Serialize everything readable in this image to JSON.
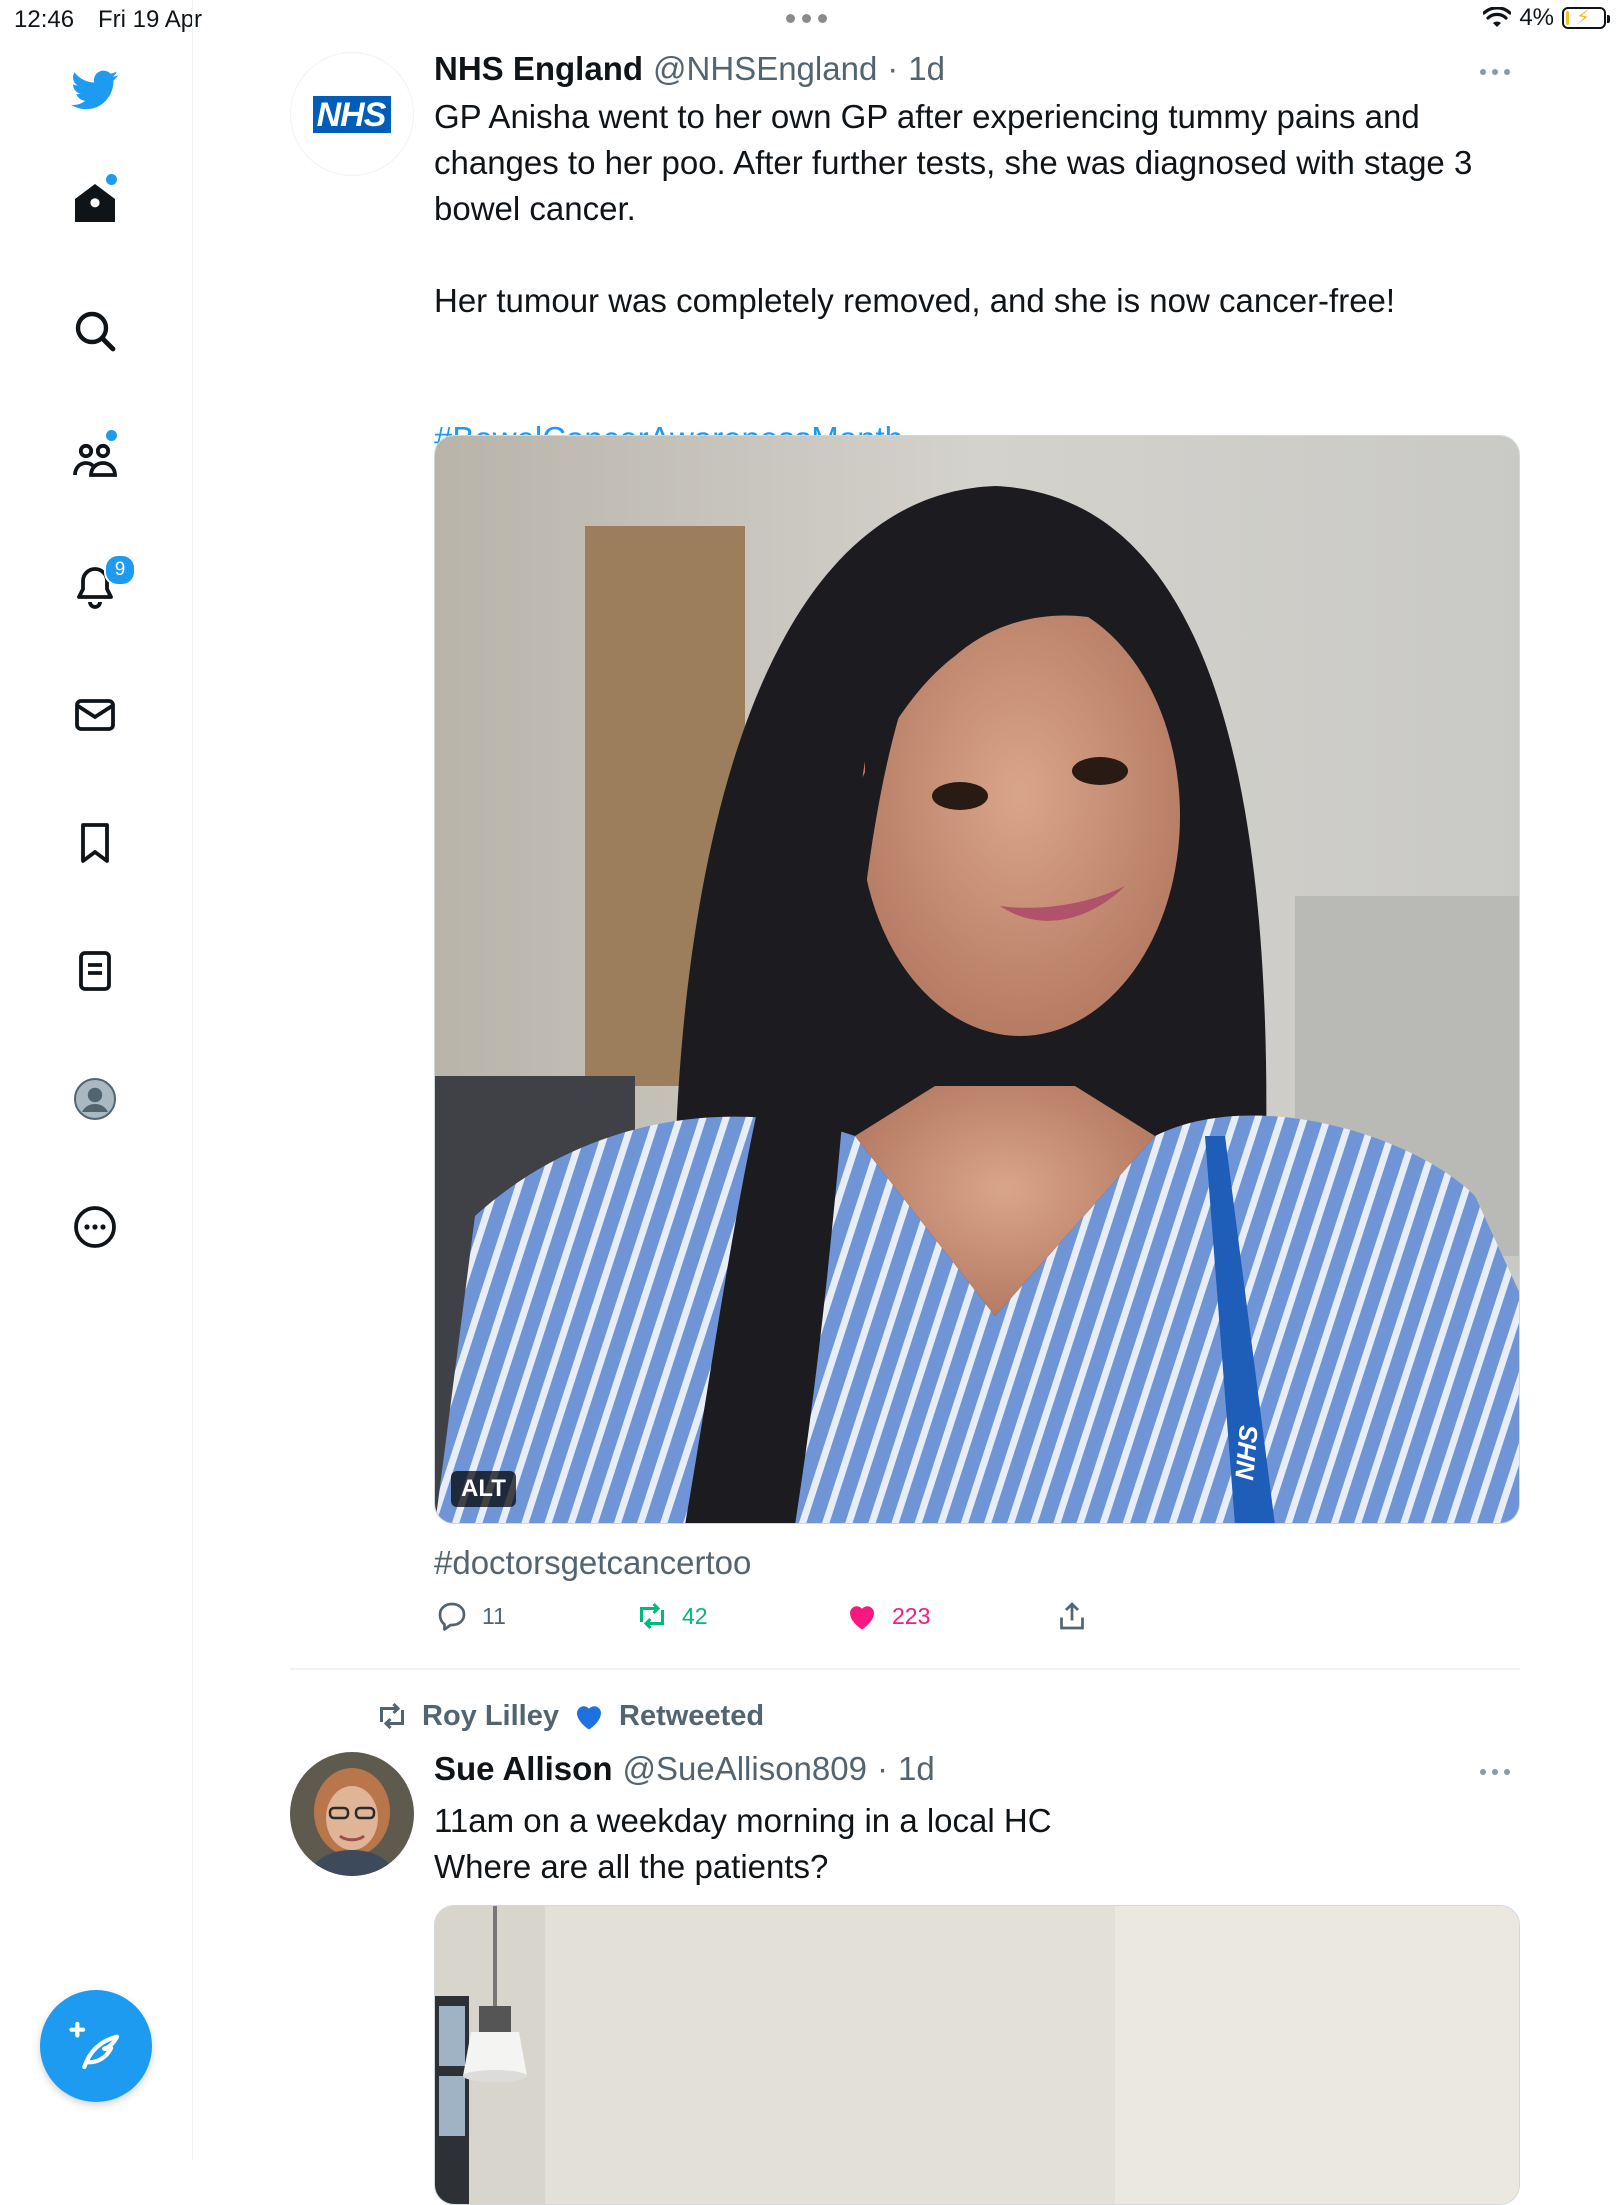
{
  "status_bar": {
    "time": "12:46",
    "date": "Fri 19 Apr",
    "battery": "4%"
  },
  "sidebar": {
    "items": [
      {
        "icon": "twitter-bird-icon"
      },
      {
        "icon": "home-icon",
        "has_dot": true
      },
      {
        "icon": "search-icon"
      },
      {
        "icon": "communities-icon",
        "has_dot": true
      },
      {
        "icon": "notifications-bell-icon",
        "badge": "9"
      },
      {
        "icon": "messages-envelope-icon"
      },
      {
        "icon": "bookmark-icon"
      },
      {
        "icon": "lists-icon"
      },
      {
        "icon": "profile-avatar-icon"
      },
      {
        "icon": "more-circle-icon"
      }
    ],
    "compose_icon": "compose-tweet-icon"
  },
  "tweets": [
    {
      "name": "NHS England",
      "handle": "@NHSEngland",
      "separator": "·",
      "time": "1d",
      "avatar_logo": "NHS",
      "text": "GP Anisha went to her own GP after experiencing tummy pains and changes to her poo. After further tests, she was diagnosed with stage 3 bowel cancer.\n\nHer tumour was completely removed, and she is now cancer-free!",
      "hashtag": "#BowelCancerAwarenessMonth",
      "media_alt_label": "ALT",
      "lanyard_text": "NHS",
      "media_caption": "#doctorsgetcancertoo",
      "replies": "11",
      "retweets": "42",
      "likes": "223"
    },
    {
      "retweeted_by": "Roy Lilley",
      "retweeted_label": "Retweeted",
      "name": "Sue Allison",
      "handle": "@SueAllison809",
      "separator": "·",
      "time": "1d",
      "text": "11am on a weekday morning in a local HC\nWhere are all the patients?"
    }
  ],
  "colors": {
    "accent": "#1d9bf0",
    "retweet": "#00ba7c",
    "like": "#f91880",
    "secondary_text": "#536471",
    "nhs_blue": "#005eb8"
  }
}
